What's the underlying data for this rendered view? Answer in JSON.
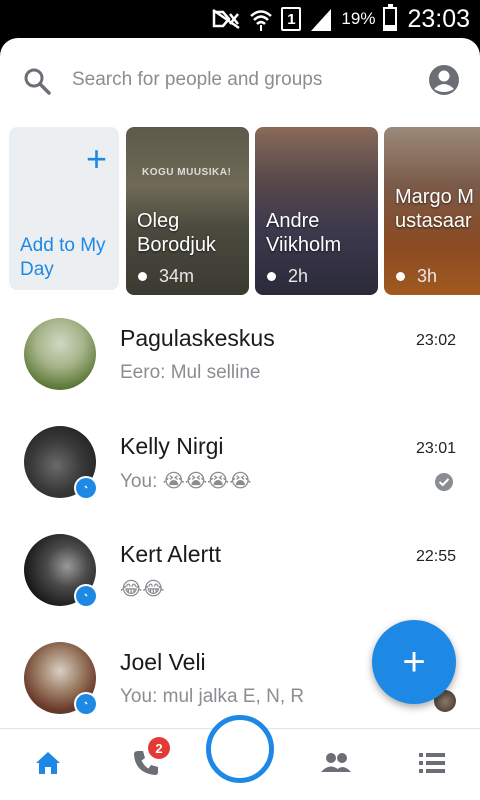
{
  "status_bar": {
    "sim_label": "1",
    "battery": "19%",
    "time": "23:03"
  },
  "search": {
    "placeholder": "Search for people and groups"
  },
  "stories": {
    "add_label": "Add to My Day",
    "items": [
      {
        "name": "Oleg Borodjuk",
        "time": "34m",
        "banner": "KOGU MUUSIKA!"
      },
      {
        "name": "Andre Viikholm",
        "time": "2h"
      },
      {
        "name": "Margo Mustasaar",
        "time": "3h"
      }
    ]
  },
  "conversations": [
    {
      "name": "Pagulaskeskus",
      "snippet": "Eero: Mul selline",
      "time": "23:02",
      "messenger_badge": false
    },
    {
      "name": "Kelly Nirgi",
      "snippet": "You: 😭😭😭😭",
      "time": "23:01",
      "messenger_badge": true,
      "status": "seen-check"
    },
    {
      "name": "Kert Alertt",
      "snippet": "😂😂",
      "time": "22:55",
      "messenger_badge": true
    },
    {
      "name": "Joel Veli",
      "snippet": "You: mul jalka E, N, R",
      "time": "",
      "messenger_badge": true
    }
  ],
  "fab": {
    "icon": "plus-icon"
  },
  "bottom_nav": {
    "calls_badge": "2",
    "items": [
      "home-icon",
      "phone-icon",
      "camera-button",
      "people-icon",
      "list-icon"
    ]
  },
  "colors": {
    "accent": "#1e88e5",
    "badge_red": "#e53935",
    "muted_text": "#8a8d91"
  }
}
